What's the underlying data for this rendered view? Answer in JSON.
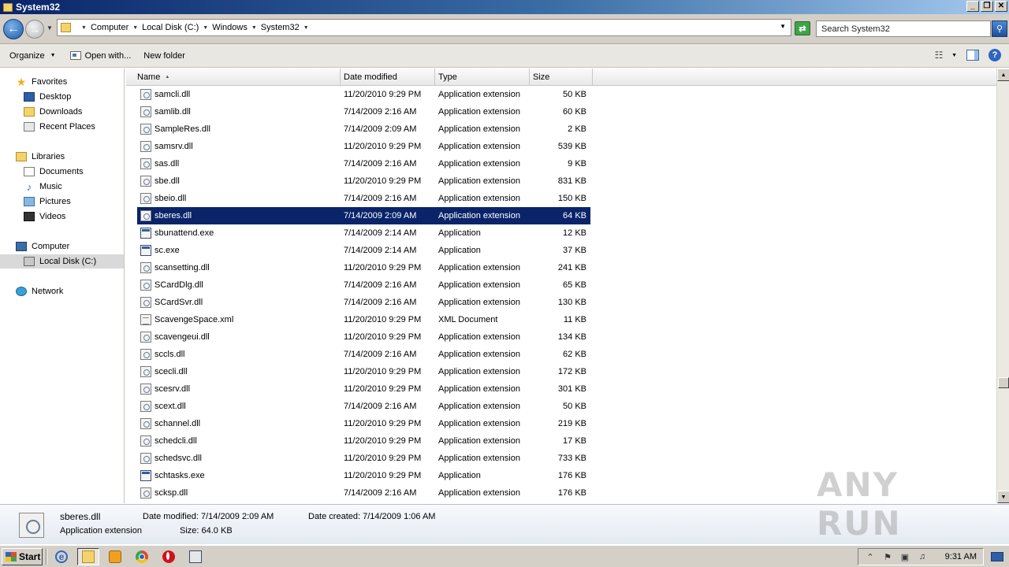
{
  "window": {
    "title": "System32"
  },
  "address": {
    "crumbs": [
      "Computer",
      "Local Disk (C:)",
      "Windows",
      "System32"
    ]
  },
  "search": {
    "placeholder": "Search System32"
  },
  "toolbar": {
    "organize": "Organize",
    "open_with": "Open with...",
    "new_folder": "New folder"
  },
  "nav": {
    "favorites": "Favorites",
    "desktop": "Desktop",
    "downloads": "Downloads",
    "recent": "Recent Places",
    "libraries": "Libraries",
    "documents": "Documents",
    "music": "Music",
    "pictures": "Pictures",
    "videos": "Videos",
    "computer": "Computer",
    "local_disk": "Local Disk (C:)",
    "network": "Network"
  },
  "columns": {
    "name": "Name",
    "date": "Date modified",
    "type": "Type",
    "size": "Size"
  },
  "files": [
    {
      "name": "samcli.dll",
      "date": "11/20/2010 9:29 PM",
      "type": "Application extension",
      "size": "50 KB",
      "icon": "dll"
    },
    {
      "name": "samlib.dll",
      "date": "7/14/2009 2:16 AM",
      "type": "Application extension",
      "size": "60 KB",
      "icon": "dll"
    },
    {
      "name": "SampleRes.dll",
      "date": "7/14/2009 2:09 AM",
      "type": "Application extension",
      "size": "2 KB",
      "icon": "dll"
    },
    {
      "name": "samsrv.dll",
      "date": "11/20/2010 9:29 PM",
      "type": "Application extension",
      "size": "539 KB",
      "icon": "dll"
    },
    {
      "name": "sas.dll",
      "date": "7/14/2009 2:16 AM",
      "type": "Application extension",
      "size": "9 KB",
      "icon": "dll"
    },
    {
      "name": "sbe.dll",
      "date": "11/20/2010 9:29 PM",
      "type": "Application extension",
      "size": "831 KB",
      "icon": "dll"
    },
    {
      "name": "sbeio.dll",
      "date": "7/14/2009 2:16 AM",
      "type": "Application extension",
      "size": "150 KB",
      "icon": "dll"
    },
    {
      "name": "sberes.dll",
      "date": "7/14/2009 2:09 AM",
      "type": "Application extension",
      "size": "64 KB",
      "icon": "dll",
      "selected": true
    },
    {
      "name": "sbunattend.exe",
      "date": "7/14/2009 2:14 AM",
      "type": "Application",
      "size": "12 KB",
      "icon": "exe"
    },
    {
      "name": "sc.exe",
      "date": "7/14/2009 2:14 AM",
      "type": "Application",
      "size": "37 KB",
      "icon": "exe"
    },
    {
      "name": "scansetting.dll",
      "date": "11/20/2010 9:29 PM",
      "type": "Application extension",
      "size": "241 KB",
      "icon": "dll"
    },
    {
      "name": "SCardDlg.dll",
      "date": "7/14/2009 2:16 AM",
      "type": "Application extension",
      "size": "65 KB",
      "icon": "dll"
    },
    {
      "name": "SCardSvr.dll",
      "date": "7/14/2009 2:16 AM",
      "type": "Application extension",
      "size": "130 KB",
      "icon": "dll"
    },
    {
      "name": "ScavengeSpace.xml",
      "date": "11/20/2010 9:29 PM",
      "type": "XML Document",
      "size": "11 KB",
      "icon": "xml"
    },
    {
      "name": "scavengeui.dll",
      "date": "11/20/2010 9:29 PM",
      "type": "Application extension",
      "size": "134 KB",
      "icon": "dll"
    },
    {
      "name": "sccls.dll",
      "date": "7/14/2009 2:16 AM",
      "type": "Application extension",
      "size": "62 KB",
      "icon": "dll"
    },
    {
      "name": "scecli.dll",
      "date": "11/20/2010 9:29 PM",
      "type": "Application extension",
      "size": "172 KB",
      "icon": "dll"
    },
    {
      "name": "scesrv.dll",
      "date": "11/20/2010 9:29 PM",
      "type": "Application extension",
      "size": "301 KB",
      "icon": "dll"
    },
    {
      "name": "scext.dll",
      "date": "7/14/2009 2:16 AM",
      "type": "Application extension",
      "size": "50 KB",
      "icon": "dll"
    },
    {
      "name": "schannel.dll",
      "date": "11/20/2010 9:29 PM",
      "type": "Application extension",
      "size": "219 KB",
      "icon": "dll"
    },
    {
      "name": "schedcli.dll",
      "date": "11/20/2010 9:29 PM",
      "type": "Application extension",
      "size": "17 KB",
      "icon": "dll"
    },
    {
      "name": "schedsvc.dll",
      "date": "11/20/2010 9:29 PM",
      "type": "Application extension",
      "size": "733 KB",
      "icon": "dll"
    },
    {
      "name": "schtasks.exe",
      "date": "11/20/2010 9:29 PM",
      "type": "Application",
      "size": "176 KB",
      "icon": "exe"
    },
    {
      "name": "scksp.dll",
      "date": "7/14/2009 2:16 AM",
      "type": "Application extension",
      "size": "176 KB",
      "icon": "dll"
    }
  ],
  "details": {
    "name": "sberes.dll",
    "type": "Application extension",
    "date_modified": "Date modified: 7/14/2009 2:09 AM",
    "date_created": "Date created: 7/14/2009 1:06 AM",
    "size": "Size: 64.0 KB"
  },
  "watermark": "ANY RUN",
  "taskbar": {
    "start": "Start",
    "clock": "9:31 AM"
  },
  "colors": {
    "selection": "#0a246a",
    "titlebar": "#0a246a",
    "chrome": "#d4d0c8"
  }
}
